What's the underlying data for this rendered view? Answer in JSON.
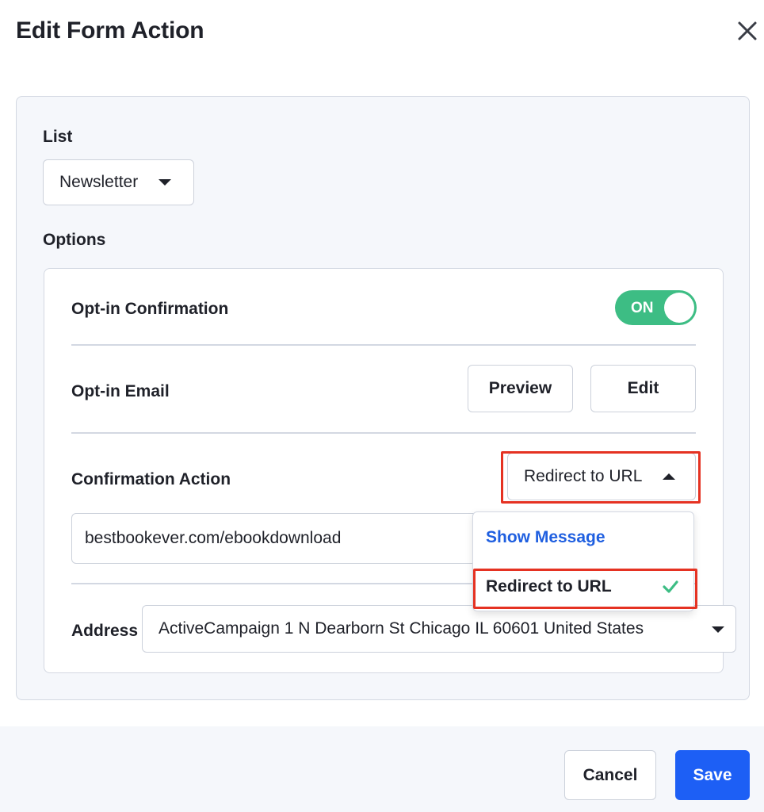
{
  "dialog": {
    "title": "Edit Form Action"
  },
  "list": {
    "label": "List",
    "selected": "Newsletter"
  },
  "options": {
    "label": "Options",
    "opt_in_confirmation": {
      "label": "Opt-in Confirmation",
      "toggle_text": "ON"
    },
    "opt_in_email": {
      "label": "Opt-in Email",
      "preview_label": "Preview",
      "edit_label": "Edit"
    },
    "confirmation_action": {
      "label": "Confirmation Action",
      "selected": "Redirect to URL",
      "url_value": "bestbookever.com/ebookdownload",
      "menu": [
        {
          "label": "Show Message"
        },
        {
          "label": "Redirect to URL"
        }
      ]
    },
    "address": {
      "label": "Address",
      "selected": "ActiveCampaign 1 N Dearborn St Chicago IL 60601 United States"
    }
  },
  "footer": {
    "cancel_label": "Cancel",
    "save_label": "Save"
  },
  "colors": {
    "primary": "#1d5ff5",
    "toggle_on": "#3dbd84",
    "highlight": "#e53222",
    "link": "#1f5fe0"
  }
}
